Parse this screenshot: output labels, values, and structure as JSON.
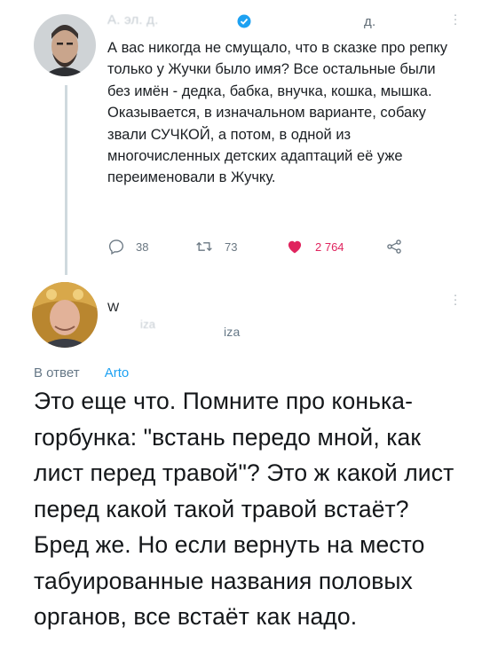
{
  "tweet1": {
    "author_name": "А. эл. д.",
    "author_suffix": "д.",
    "text": "А вас никогда не смущало, что в сказке про репку только у Жучки было имя? Все остальные были без имён - дедка, бабка, внучка, кошка, мышка. Оказывается, в изначальном варианте, собаку звали СУЧКОЙ, а потом, в одной из многочисленных детских адаптаций её уже переименовали в Жучку.",
    "replies": "38",
    "retweets": "73",
    "likes": "2 764",
    "icons": [
      "reply-icon",
      "retweet-icon",
      "heart-icon",
      "share-icon",
      "verified-badge-icon",
      "more-icon"
    ]
  },
  "tweet2": {
    "author_name": "W",
    "author_handle": "iza",
    "author_handle2": "iza",
    "reply_prefix": "В ответ",
    "reply_mention": "Arto",
    "text": "Это еще что. Помните про конька-горбунка: \"встань передо мной, как лист перед травой\"? Это ж какой лист перед какой такой травой встаёт? Бред же. Но если вернуть на место табуированные названия половых органов, все встаёт как надо."
  },
  "colors": {
    "accent": "#1da1f2",
    "like": "#e0245e",
    "muted": "#657786",
    "thread_line": "#cfd9de"
  }
}
